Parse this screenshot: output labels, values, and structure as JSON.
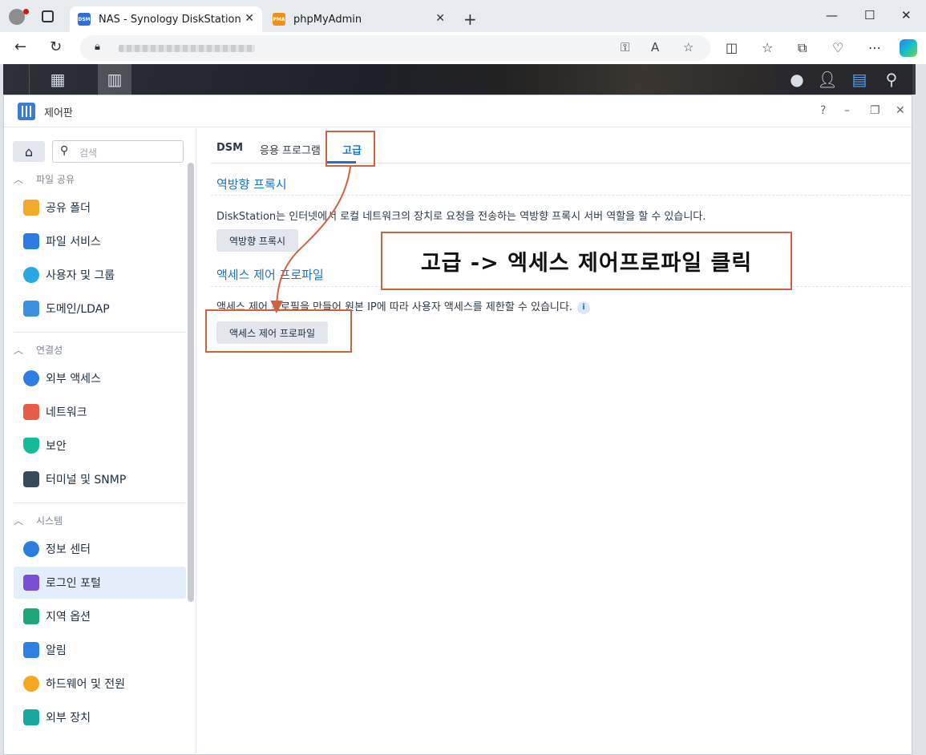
{
  "browser": {
    "tabs": [
      {
        "label": "NAS - Synology DiskStation",
        "favicon": "DSM",
        "active": true
      },
      {
        "label": "phpMyAdmin",
        "favicon": "PMA",
        "active": false
      }
    ]
  },
  "window": {
    "title": "제어판",
    "controls": [
      "?",
      "–",
      "❐",
      "✕"
    ]
  },
  "sidebar": {
    "search_placeholder": "검색",
    "sections": [
      {
        "label": "파일 공유",
        "items": [
          {
            "label": "공유 폴더",
            "icon": "shared-folder-icon"
          },
          {
            "label": "파일 서비스",
            "icon": "file-services-icon"
          },
          {
            "label": "사용자 및 그룹",
            "icon": "user-group-icon"
          },
          {
            "label": "도메인/LDAP",
            "icon": "domain-ldap-icon"
          }
        ]
      },
      {
        "label": "연결성",
        "items": [
          {
            "label": "외부 액세스",
            "icon": "external-access-icon"
          },
          {
            "label": "네트워크",
            "icon": "network-icon"
          },
          {
            "label": "보안",
            "icon": "security-icon"
          },
          {
            "label": "터미널 및 SNMP",
            "icon": "terminal-icon"
          }
        ]
      },
      {
        "label": "시스템",
        "items": [
          {
            "label": "정보 센터",
            "icon": "info-center-icon"
          },
          {
            "label": "로그인 포털",
            "icon": "login-portal-icon",
            "selected": true
          },
          {
            "label": "지역 옵션",
            "icon": "regional-options-icon"
          },
          {
            "label": "알림",
            "icon": "notification-icon"
          },
          {
            "label": "하드웨어 및 전원",
            "icon": "hardware-power-icon"
          },
          {
            "label": "외부 장치",
            "icon": "external-devices-icon"
          }
        ]
      }
    ]
  },
  "main": {
    "tabs": [
      {
        "label": "DSM"
      },
      {
        "label": "응용 프로그램"
      },
      {
        "label": "고급",
        "active": true
      }
    ],
    "reverse_proxy": {
      "title": "역방향 프록시",
      "description": "DiskStation는 인터넷에서 로컬 네트워크의 장치로 요청을 전송하는 역방향 프록시 서버 역할을 할 수 있습니다.",
      "button": "역방향 프록시"
    },
    "access_control": {
      "title": "액세스 제어 프로파일",
      "description": "액세스 제어 프로필을 만들어 원본 IP에 따라 사용자 액세스를 제한할 수 있습니다.",
      "button": "액세스 제어 프로파일"
    }
  },
  "annotation": {
    "callout": "고급 -> 엑세스 제어프로파일 클릭",
    "color": "#d0613e"
  },
  "colors": {
    "accent": "#1a73c9",
    "selected_bg": "#e3eefb"
  }
}
